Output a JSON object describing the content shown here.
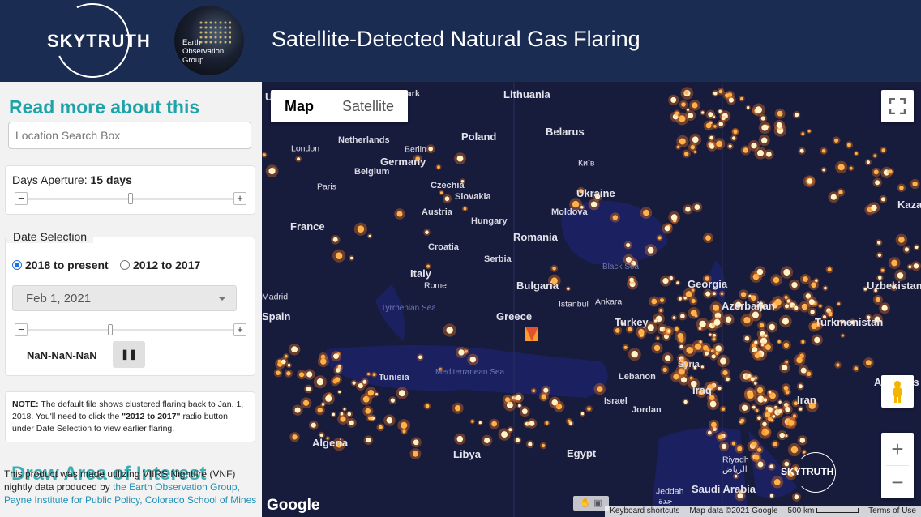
{
  "header": {
    "logo_text": "SKYTRUTH",
    "eog_logo_text": "Earth Observation Group",
    "title": "Satellite-Detected Natural Gas Flaring"
  },
  "sidebar": {
    "read_more": "Read more about this",
    "search_placeholder": "Location Search Box",
    "aperture_label": "Days Aperture:",
    "aperture_value": "15 days",
    "aperture_level": 0.5,
    "date_legend": "Date Selection",
    "radio_2018": "2018 to present",
    "radio_2012": "2012 to 2017",
    "date_value": "Feb 1, 2021",
    "date_level": 0.4,
    "play_label": "NaN-NaN-NaN",
    "pause_icon": "pause-icon",
    "note_label": "NOTE:",
    "note_text_1": " The default file shows clustered flaring back to Jan. 1, 2018. You'll need to click the ",
    "note_bold": "\"2012 to 2017\"",
    "note_text_2": " radio button under Date Selection to view earlier flaring.",
    "draw_aoi": "Draw Area of Interest",
    "credits_text": "This product was made utilizing VIIRS Nightfire (VNF) nightly data produced by ",
    "credits_link": "the Earth Observation Group, Payne Institute for Public Policy, Colorado School of Mines"
  },
  "map": {
    "type_map": "Map",
    "type_satellite": "Satellite",
    "zoom_in": "+",
    "zoom_out": "−",
    "google": "Google",
    "attrib_shortcuts": "Keyboard shortcuts",
    "attrib_data": "Map data ©2021 Google",
    "attrib_scale": "500 km",
    "attrib_terms": "Terms of Use",
    "watermark": "SKYTRUTH",
    "labels": [
      {
        "text": "United",
        "cls": "country"
      },
      {
        "text": "Denmark",
        "cls": "small"
      },
      {
        "text": "Lithuania",
        "cls": "country"
      },
      {
        "text": "Poland",
        "cls": "country"
      },
      {
        "text": "Belarus",
        "cls": "country"
      },
      {
        "text": "Netherlands",
        "cls": "small"
      },
      {
        "text": "London",
        "cls": "city"
      },
      {
        "text": "Berlin",
        "cls": "city"
      },
      {
        "text": "Germany",
        "cls": "country"
      },
      {
        "text": "Київ",
        "cls": "city"
      },
      {
        "text": "Belgium",
        "cls": "small"
      },
      {
        "text": "Paris",
        "cls": "city"
      },
      {
        "text": "Czechia",
        "cls": "small"
      },
      {
        "text": "Slovakia",
        "cls": "small"
      },
      {
        "text": "Ukraine",
        "cls": "country"
      },
      {
        "text": "Austria",
        "cls": "small"
      },
      {
        "text": "Moldova",
        "cls": "small"
      },
      {
        "text": "France",
        "cls": "country"
      },
      {
        "text": "Hungary",
        "cls": "small"
      },
      {
        "text": "Romania",
        "cls": "country"
      },
      {
        "text": "Croatia",
        "cls": "small"
      },
      {
        "text": "Serbia",
        "cls": "small"
      },
      {
        "text": "Italy",
        "cls": "country"
      },
      {
        "text": "Black Sea",
        "cls": "sea"
      },
      {
        "text": "Georgia",
        "cls": "country"
      },
      {
        "text": "Rome",
        "cls": "city"
      },
      {
        "text": "Bulgaria",
        "cls": "country"
      },
      {
        "text": "Madrid",
        "cls": "city"
      },
      {
        "text": "Ankara",
        "cls": "city"
      },
      {
        "text": "Istanbul",
        "cls": "city"
      },
      {
        "text": "Azerbaijan",
        "cls": "country"
      },
      {
        "text": "Spain",
        "cls": "country"
      },
      {
        "text": "Tyrrhenian Sea",
        "cls": "sea"
      },
      {
        "text": "Greece",
        "cls": "country"
      },
      {
        "text": "Turkey",
        "cls": "country"
      },
      {
        "text": "Turkmenistan",
        "cls": "country"
      },
      {
        "text": "Uzbekistan",
        "cls": "country"
      },
      {
        "text": "Kaza",
        "cls": "country"
      },
      {
        "text": "Mediterranean Sea",
        "cls": "sea"
      },
      {
        "text": "Tunisia",
        "cls": "small"
      },
      {
        "text": "Syria",
        "cls": "small"
      },
      {
        "text": "Lebanon",
        "cls": "small"
      },
      {
        "text": "Iraq",
        "cls": "country"
      },
      {
        "text": "Afghanis",
        "cls": "country"
      },
      {
        "text": "Iran",
        "cls": "country"
      },
      {
        "text": "Israel",
        "cls": "small"
      },
      {
        "text": "Jordan",
        "cls": "small"
      },
      {
        "text": "Algeria",
        "cls": "country"
      },
      {
        "text": "Libya",
        "cls": "country"
      },
      {
        "text": "Egypt",
        "cls": "country"
      },
      {
        "text": "Riyadh",
        "cls": "city"
      },
      {
        "text": "الرياض",
        "cls": "city"
      },
      {
        "text": "Saudi Arabia",
        "cls": "country"
      },
      {
        "text": "Jeddah",
        "cls": "city"
      },
      {
        "text": "جدة",
        "cls": "city"
      }
    ]
  },
  "colors": {
    "header_bg": "#1b2c52",
    "accent": "#1ea3a8",
    "map_bg": "#161a3a",
    "water": "#1a1f52",
    "flare": "#ffb347"
  }
}
